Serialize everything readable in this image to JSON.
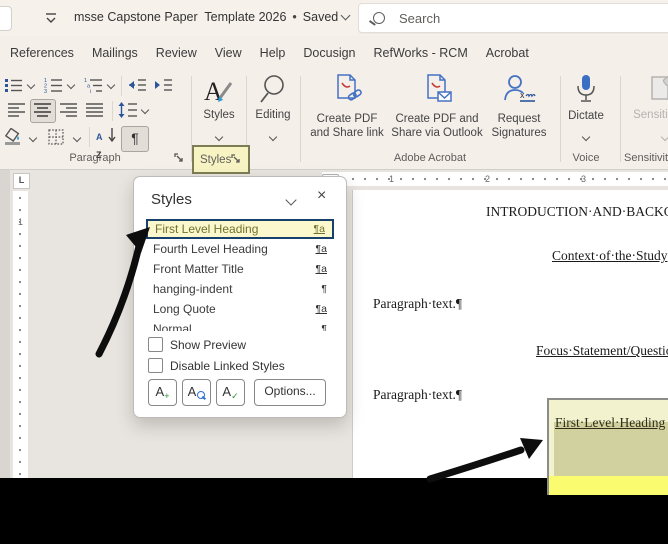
{
  "titlebar": {
    "document_title": "msse Capstone Paper  Template 2026",
    "separator": "•",
    "save_status": "Saved",
    "search_placeholder": "Search"
  },
  "ribbon": {
    "tabs": [
      "References",
      "Mailings",
      "Review",
      "View",
      "Help",
      "Docusign",
      "RefWorks - RCM",
      "Acrobat"
    ],
    "paragraph": {
      "label": "Paragraph"
    },
    "styles": {
      "label": "Styles"
    },
    "editing": {
      "label": "Editing"
    },
    "acrobat": {
      "label": "Adobe Acrobat",
      "buttons": [
        {
          "line1": "Create PDF",
          "line2": "and Share link"
        },
        {
          "line1": "Create PDF and",
          "line2": "Share via Outlook"
        },
        {
          "line1": "Request",
          "line2": "Signatures"
        }
      ]
    },
    "voice": {
      "button": "Dictate",
      "label": "Voice"
    },
    "sensitivity": {
      "button": "Sensitivity",
      "label": "Sensitivity"
    }
  },
  "annotation": {
    "styles_label": "Styles"
  },
  "styles_panel": {
    "title": "Styles",
    "items": [
      {
        "name": "First Level Heading",
        "glyph": "¶a",
        "selected": true
      },
      {
        "name": "Fourth Level Heading",
        "glyph": "¶a",
        "selected": false
      },
      {
        "name": "Front Matter Title",
        "glyph": "¶a",
        "selected": false
      },
      {
        "name": "hanging-indent",
        "glyph": "¶",
        "selected": false
      },
      {
        "name": "Long Quote",
        "glyph": "¶a",
        "selected": false
      },
      {
        "name": "Normal",
        "glyph": "¶",
        "selected": false
      }
    ],
    "show_preview": "Show Preview",
    "disable_linked": "Disable Linked Styles",
    "options": "Options..."
  },
  "document": {
    "h1": "INTRODUCTION·AND·BACKGROUND",
    "h2": "Context·of·the·Study",
    "p1": "Paragraph·text.¶",
    "h3": "Focus·Statement/Questions",
    "p2": "Paragraph·text.¶",
    "callout_text": "First·Level·Heading"
  },
  "rulers": {
    "horizontal": [
      "1",
      "2",
      "3"
    ],
    "vertical": [
      "1"
    ]
  },
  "icons": {
    "close": "×",
    "pilcrow": "¶",
    "sort_a": "A",
    "sort_z": "Z",
    "new_style_plus": "+",
    "manage_check": "✓",
    "letter_a": "A"
  },
  "colors": {
    "accent_blue": "#2b579a",
    "selection_border": "#17406d",
    "selected_item_bg": "#fcf8cd",
    "annotation_yellow": "#f7f3c3",
    "annotation_border": "#7d7d55",
    "callout_bg": "#f2f2cf",
    "callout_selection": "#d1d1a0",
    "highlight_yellow": "#fbfb70",
    "redaction_black": "#000000"
  }
}
